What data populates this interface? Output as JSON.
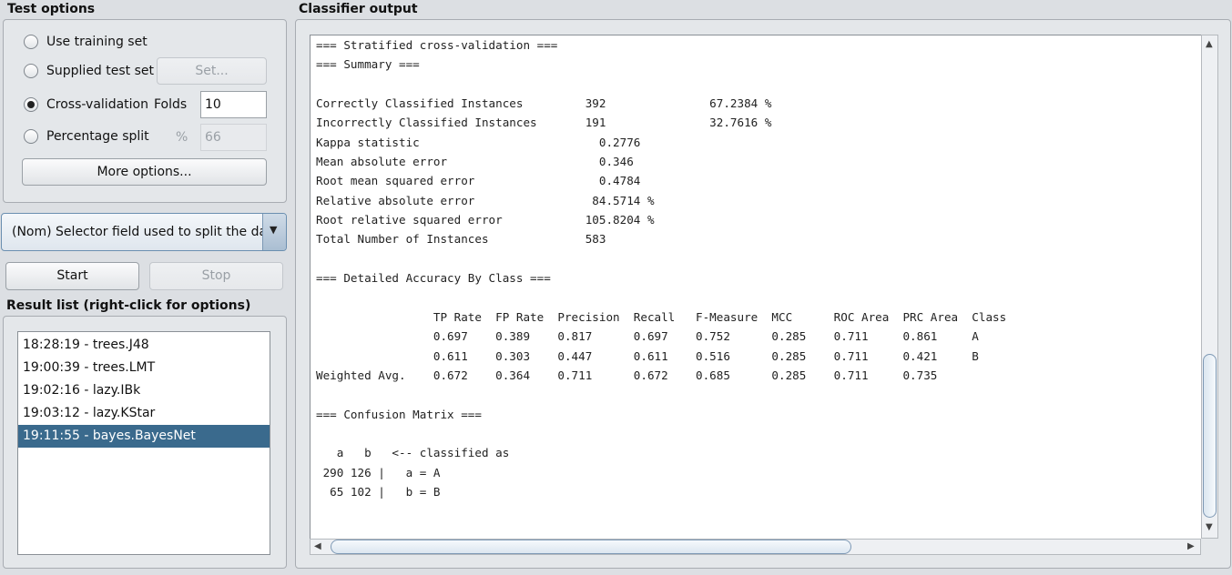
{
  "test_options": {
    "title": "Test options",
    "use_training_set": "Use training set",
    "supplied_test_set": "Supplied test set",
    "set_button": "Set...",
    "cross_validation": "Cross-validation",
    "folds_label": "Folds",
    "folds_value": "10",
    "percentage_split": "Percentage split",
    "percent_symbol": "%",
    "percentage_value": "66",
    "more_options": "More options...",
    "selected": "cross-validation"
  },
  "selector": {
    "label": "(Nom) Selector field used to split the data",
    "arrow": "▼"
  },
  "controls": {
    "start": "Start",
    "stop": "Stop"
  },
  "result_list": {
    "title": "Result list (right-click for options)",
    "items": [
      "18:28:19 - trees.J48",
      "19:00:39 - trees.LMT",
      "19:02:16 - lazy.IBk",
      "19:03:12 - lazy.KStar",
      "19:11:55 - bayes.BayesNet"
    ],
    "selected_index": 4
  },
  "classifier_output": {
    "title": "Classifier output",
    "lines": [
      "=== Stratified cross-validation ===",
      "=== Summary ===",
      "",
      "Correctly Classified Instances         392               67.2384 %",
      "Incorrectly Classified Instances       191               32.7616 %",
      "Kappa statistic                          0.2776",
      "Mean absolute error                      0.346",
      "Root mean squared error                  0.4784",
      "Relative absolute error                 84.5714 %",
      "Root relative squared error            105.8204 %",
      "Total Number of Instances              583",
      "",
      "=== Detailed Accuracy By Class ===",
      "",
      "                 TP Rate  FP Rate  Precision  Recall   F-Measure  MCC      ROC Area  PRC Area  Class",
      "                 0.697    0.389    0.817      0.697    0.752      0.285    0.711     0.861     A",
      "                 0.611    0.303    0.447      0.611    0.516      0.285    0.711     0.421     B",
      "Weighted Avg.    0.672    0.364    0.711      0.672    0.685      0.285    0.711     0.735",
      "",
      "=== Confusion Matrix ===",
      "",
      "   a   b   <-- classified as",
      " 290 126 |   a = A",
      "  65 102 |   b = B"
    ]
  },
  "scrollbar": {
    "up_arrow": "▲",
    "down_arrow": "▼",
    "left_arrow": "◀",
    "right_arrow": "▶"
  },
  "colors": {
    "selection": "#3a6a8d",
    "background": "#dcdfe3"
  }
}
